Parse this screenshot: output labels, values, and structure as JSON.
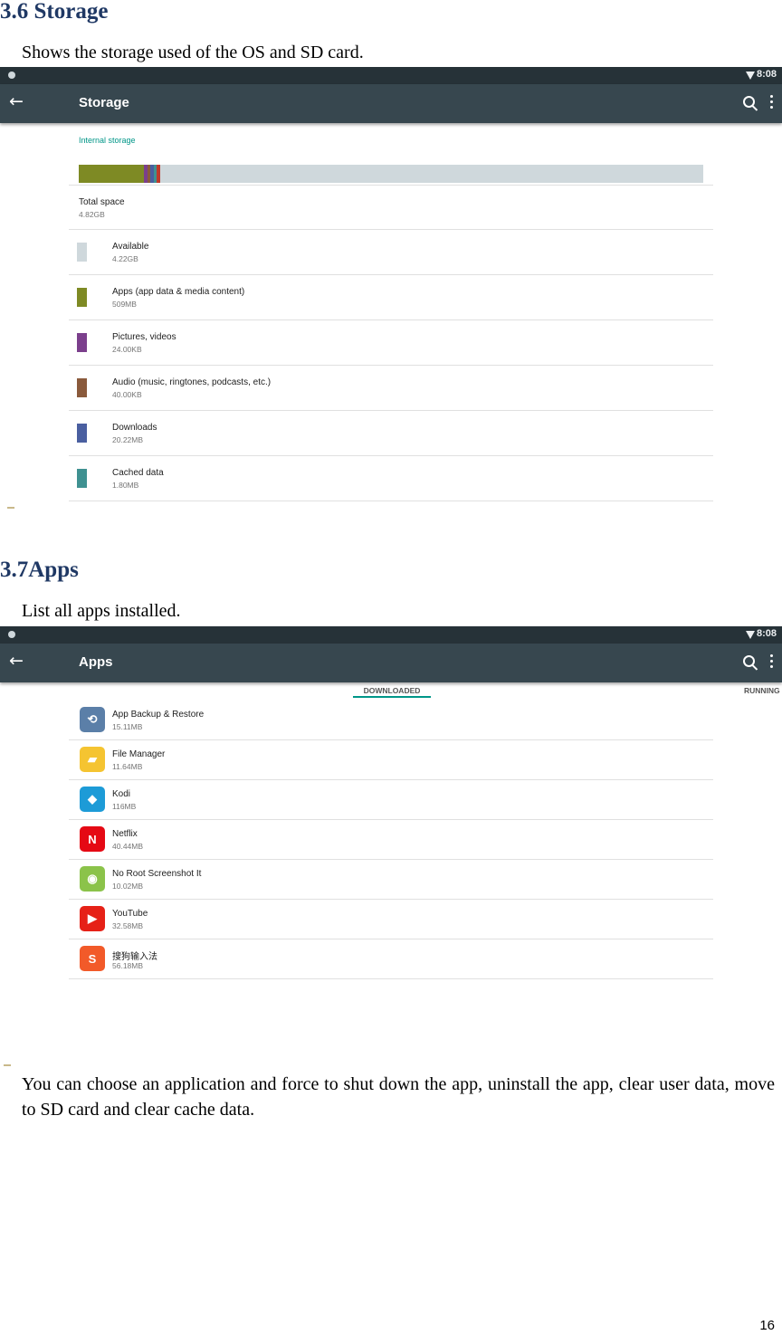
{
  "storage_section": {
    "heading": "3.6 Storage",
    "description": "Shows the storage used of the OS and SD card.",
    "screenshot": {
      "status_time": "8:08",
      "toolbar_title": "Storage",
      "section_label": "Internal storage",
      "bar_segments": [
        {
          "item": "Apps",
          "fraction": 0.105,
          "color": "#7e8a24"
        },
        {
          "item": "Pictures, videos",
          "fraction": 0.005,
          "color": "#7b3f8c"
        },
        {
          "item": "Audio",
          "fraction": 0.005,
          "color": "#8a5a3c"
        },
        {
          "item": "Downloads",
          "fraction": 0.005,
          "color": "#4a5fa0"
        },
        {
          "item": "Cached data",
          "fraction": 0.005,
          "color": "#3f9191"
        },
        {
          "item": "Misc",
          "fraction": 0.005,
          "color": "#c0392b"
        }
      ],
      "total": {
        "label": "Total space",
        "value": "4.82GB"
      },
      "items": [
        {
          "name": "Available",
          "size": "4.22GB",
          "color": "#cfd8dc"
        },
        {
          "name": "Apps (app data & media content)",
          "size": "509MB",
          "color": "#7e8a24"
        },
        {
          "name": "Pictures, videos",
          "size": "24.00KB",
          "color": "#7b3f8c"
        },
        {
          "name": "Audio (music, ringtones, podcasts, etc.)",
          "size": "40.00KB",
          "color": "#8a5a3c"
        },
        {
          "name": "Downloads",
          "size": "20.22MB",
          "color": "#4a5fa0"
        },
        {
          "name": "Cached data",
          "size": "1.80MB",
          "color": "#3f9191"
        }
      ]
    }
  },
  "apps_section": {
    "heading": "3.7Apps",
    "description": "List all apps installed.",
    "screenshot": {
      "status_time": "8:08",
      "toolbar_title": "Apps",
      "tabs": [
        "DOWNLOADED",
        "RUNNING"
      ],
      "apps": [
        {
          "name": "App Backup & Restore",
          "size": "15.11MB",
          "icon": "backup-icon",
          "icon_color": "#5b7fa8"
        },
        {
          "name": "File Manager",
          "size": "11.64MB",
          "icon": "folder-icon",
          "icon_color": "#f5c431"
        },
        {
          "name": "Kodi",
          "size": "116MB",
          "icon": "kodi-icon",
          "icon_color": "#1d9bd7"
        },
        {
          "name": "Netflix",
          "size": "40.44MB",
          "icon": "netflix-icon",
          "icon_color": "#e50914"
        },
        {
          "name": "No Root Screenshot It",
          "size": "10.02MB",
          "icon": "android-icon",
          "icon_color": "#8bc34a"
        },
        {
          "name": "YouTube",
          "size": "32.58MB",
          "icon": "youtube-icon",
          "icon_color": "#e62117"
        },
        {
          "name": "搜狗输入法",
          "size": "56.18MB",
          "icon": "sogou-icon",
          "icon_color": "#f25a29"
        }
      ]
    }
  },
  "closing_text": "You can choose an application and force to shut down the app, uninstall the app, clear user data, move to SD card and clear cache data.",
  "page_number": "16"
}
